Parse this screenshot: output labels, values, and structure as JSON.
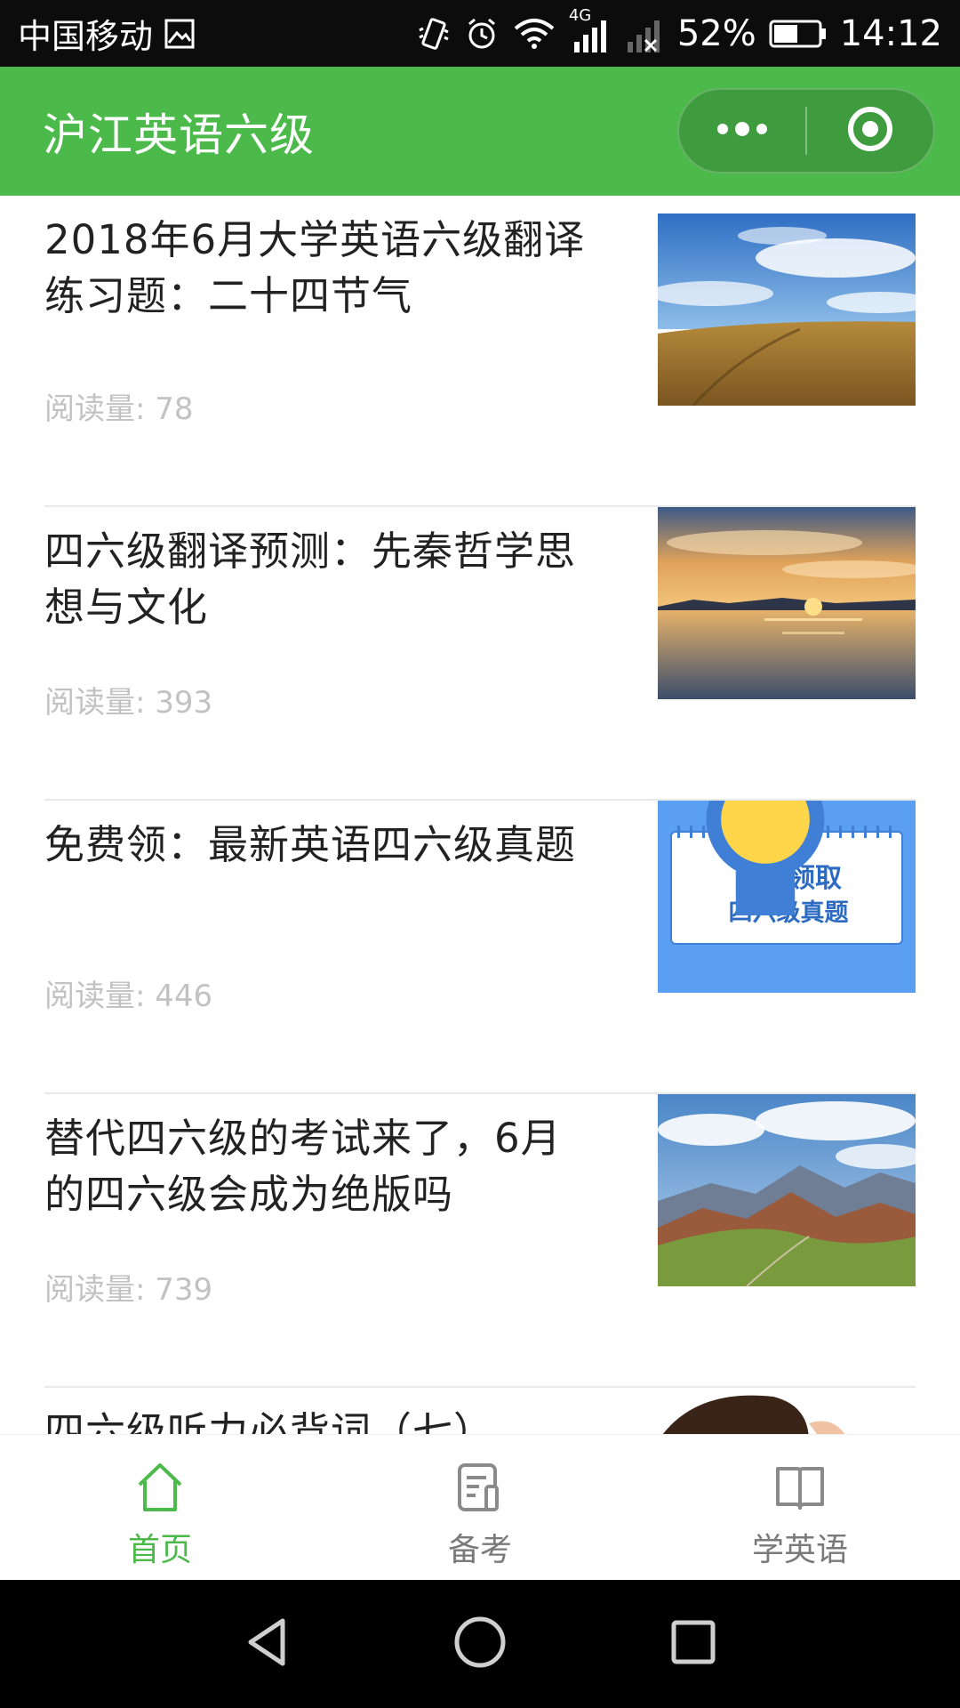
{
  "status_bar": {
    "carrier": "中国移动",
    "network": "4G",
    "battery": "52%",
    "time": "14:12"
  },
  "header": {
    "title": "沪江英语六级",
    "more_icon": "more-dots-icon",
    "close_icon": "target-circle-icon"
  },
  "articles": [
    {
      "title": "2018年6月大学英语六级翻译练习题：二十四节气",
      "reads": "阅读量: 78",
      "thumb_icon": "grassland-sky-image"
    },
    {
      "title": "四六级翻译预测：先秦哲学思想与文化",
      "reads": "阅读量: 393",
      "thumb_icon": "sunset-lake-image"
    },
    {
      "title": "免费领：最新英语四六级真题",
      "reads": "阅读量: 446",
      "thumb_line1": "免费领取",
      "thumb_line2": "四六级真题"
    },
    {
      "title": "替代四六级的考试来了，6月的四六级会成为绝版吗",
      "reads": "阅读量: 739",
      "thumb_icon": "mountains-image"
    },
    {
      "title": "四六级听力必背词（七）",
      "reads": "",
      "thumb_icon": "person-listening-image"
    }
  ],
  "tabs": [
    {
      "label": "首页",
      "icon": "home-icon",
      "active": true
    },
    {
      "label": "备考",
      "icon": "notes-icon",
      "active": false
    },
    {
      "label": "学英语",
      "icon": "book-icon",
      "active": false
    }
  ],
  "colors": {
    "brand_green": "#4cba4a",
    "thumb_blue": "#5a9ff2"
  }
}
